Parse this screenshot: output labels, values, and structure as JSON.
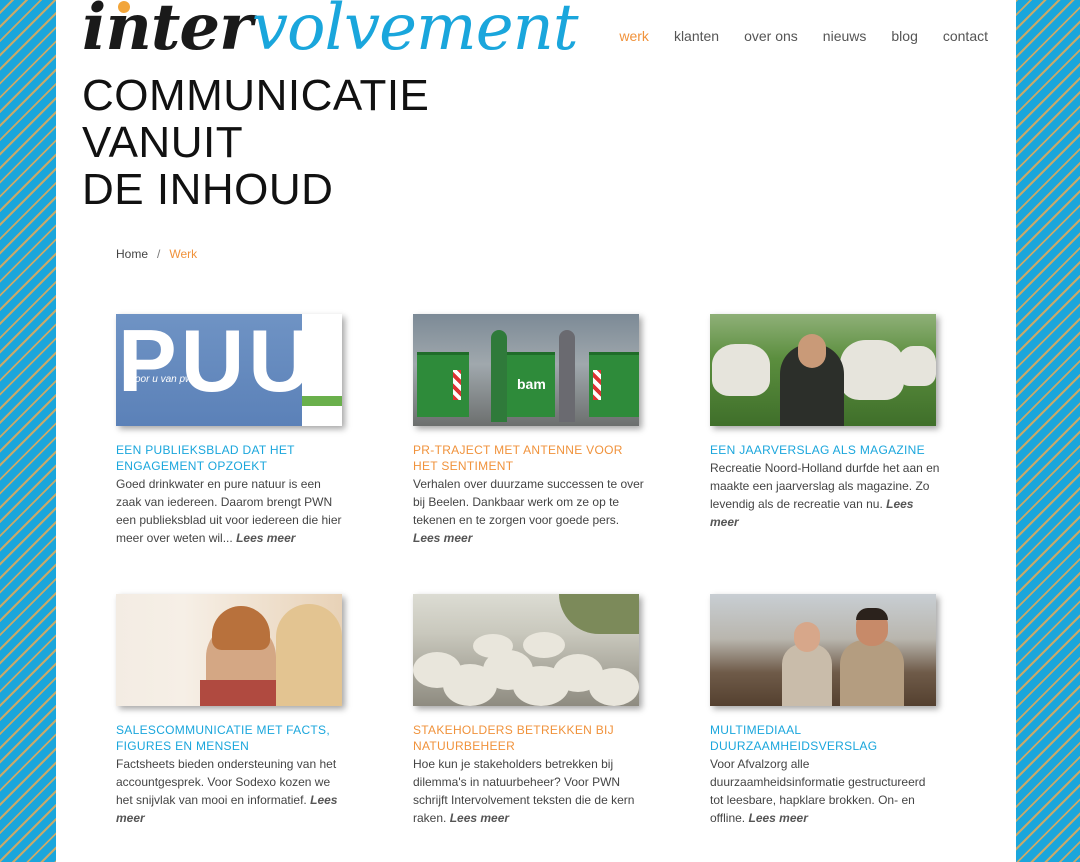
{
  "brand": {
    "logo_part1": "inter",
    "logo_part2": "volvement",
    "color_dark": "#1a1a1a",
    "color_accent": "#1aa6dc",
    "color_orange": "#f0923b"
  },
  "nav": {
    "items": [
      {
        "label": "werk",
        "active": true
      },
      {
        "label": "klanten"
      },
      {
        "label": "over ons"
      },
      {
        "label": "nieuws"
      },
      {
        "label": "blog"
      },
      {
        "label": "contact"
      }
    ]
  },
  "tagline": [
    "COMMUNICATIE",
    "VANUIT",
    "DE INHOUD"
  ],
  "breadcrumb": {
    "home": "Home",
    "separator": "/",
    "current": "Werk"
  },
  "cards": [
    {
      "title": "EEN PUBLIEKSBLAD DAT HET ENGAGEMENT OPZOEKT",
      "title_color": "blue",
      "text": "Goed drinkwater en pure natuur is een zaak van iedereen. Daarom brengt PWN een publieksblad uit voor iedereen die hier meer over weten wil...",
      "more": "Lees meer",
      "image": {
        "word": "PUUR",
        "small": "voor u van pwn"
      }
    },
    {
      "title": "PR-TRAJECT MET ANTENNE VOOR HET SENTIMENT",
      "title_color": "orange",
      "text": "Verhalen over duurzame successen te over bij Beelen. Dankbaar werk om ze op te tekenen en te zorgen voor goede pers.",
      "more": "Lees meer",
      "image": {
        "word": "bam"
      }
    },
    {
      "title": "EEN JAARVERSLAG ALS MAGAZINE",
      "title_color": "blue",
      "text": "Recreatie Noord-Holland durfde het aan en maakte een jaarverslag als magazine. Zo levendig als de recreatie van nu.",
      "more": "Lees meer"
    },
    {
      "title": "SALESCOMMUNICATIE MET FACTS, FIGURES EN MENSEN",
      "title_color": "blue",
      "text": "Factsheets bieden ondersteuning van het accountgesprek. Voor Sodexo kozen we het snijvlak van mooi en informatief.",
      "more": "Lees meer"
    },
    {
      "title": "STAKEHOLDERS BETREKKEN BIJ NATUURBEHEER",
      "title_color": "orange",
      "text": "Hoe kun je stakeholders betrekken bij dilemma's in natuurbeheer? Voor PWN schrijft Intervolvement teksten die de kern raken.",
      "more": "Lees meer"
    },
    {
      "title": "MULTIMEDIAAL DUURZAAMHEIDSVERSLAG",
      "title_color": "blue",
      "text": "Voor Afvalzorg alle duurzaamheidsinformatie gestructureerd tot leesbare, hapklare brokken. On- en offline.",
      "more": "Lees meer"
    }
  ]
}
